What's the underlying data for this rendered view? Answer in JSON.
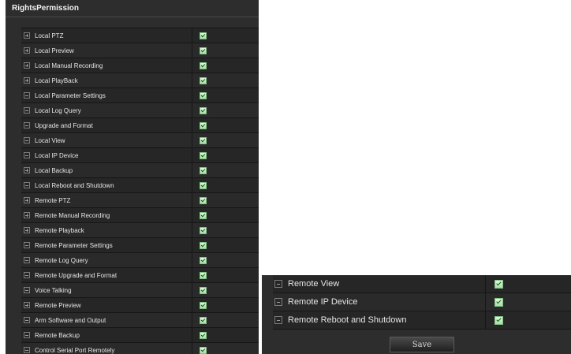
{
  "panel_title": "RightsPermission",
  "left_rows": [
    {
      "label": "Local PTZ",
      "toggle": "plus",
      "checked": true
    },
    {
      "label": "Local Preview",
      "toggle": "plus",
      "checked": true
    },
    {
      "label": "Local Manual Recording",
      "toggle": "plus",
      "checked": true
    },
    {
      "label": "Local PlayBack",
      "toggle": "plus",
      "checked": true
    },
    {
      "label": "Local Parameter Settings",
      "toggle": "minus",
      "checked": true
    },
    {
      "label": "Local Log Query",
      "toggle": "minus",
      "checked": true
    },
    {
      "label": "Upgrade and Format",
      "toggle": "minus",
      "checked": true
    },
    {
      "label": "Local View",
      "toggle": "minus",
      "checked": true
    },
    {
      "label": "Local IP Device",
      "toggle": "minus",
      "checked": true
    },
    {
      "label": "Local Backup",
      "toggle": "plus",
      "checked": true
    },
    {
      "label": "Local Reboot and Shutdown",
      "toggle": "minus",
      "checked": true
    },
    {
      "label": "Remote PTZ",
      "toggle": "plus",
      "checked": true
    },
    {
      "label": "Remote Manual Recording",
      "toggle": "plus",
      "checked": true
    },
    {
      "label": "Remote Playback",
      "toggle": "plus",
      "checked": true
    },
    {
      "label": "Remote Parameter Settings",
      "toggle": "minus",
      "checked": true
    },
    {
      "label": "Remote Log Query",
      "toggle": "minus",
      "checked": true
    },
    {
      "label": "Remote Upgrade and Format",
      "toggle": "minus",
      "checked": true
    },
    {
      "label": "Voice Talking",
      "toggle": "minus",
      "checked": true
    },
    {
      "label": "Remote Preview",
      "toggle": "plus",
      "checked": true
    },
    {
      "label": "Arm Software and Output",
      "toggle": "minus",
      "checked": true
    },
    {
      "label": "Remote Backup",
      "toggle": "minus",
      "checked": true
    },
    {
      "label": "Control Serial Port Remotely",
      "toggle": "minus",
      "checked": true
    }
  ],
  "right_rows": [
    {
      "label": "Remote View",
      "toggle": "minus",
      "checked": true
    },
    {
      "label": "Remote IP Device",
      "toggle": "minus",
      "checked": true
    },
    {
      "label": "Remote Reboot and Shutdown",
      "toggle": "minus",
      "checked": true
    }
  ],
  "save_label": "Save"
}
